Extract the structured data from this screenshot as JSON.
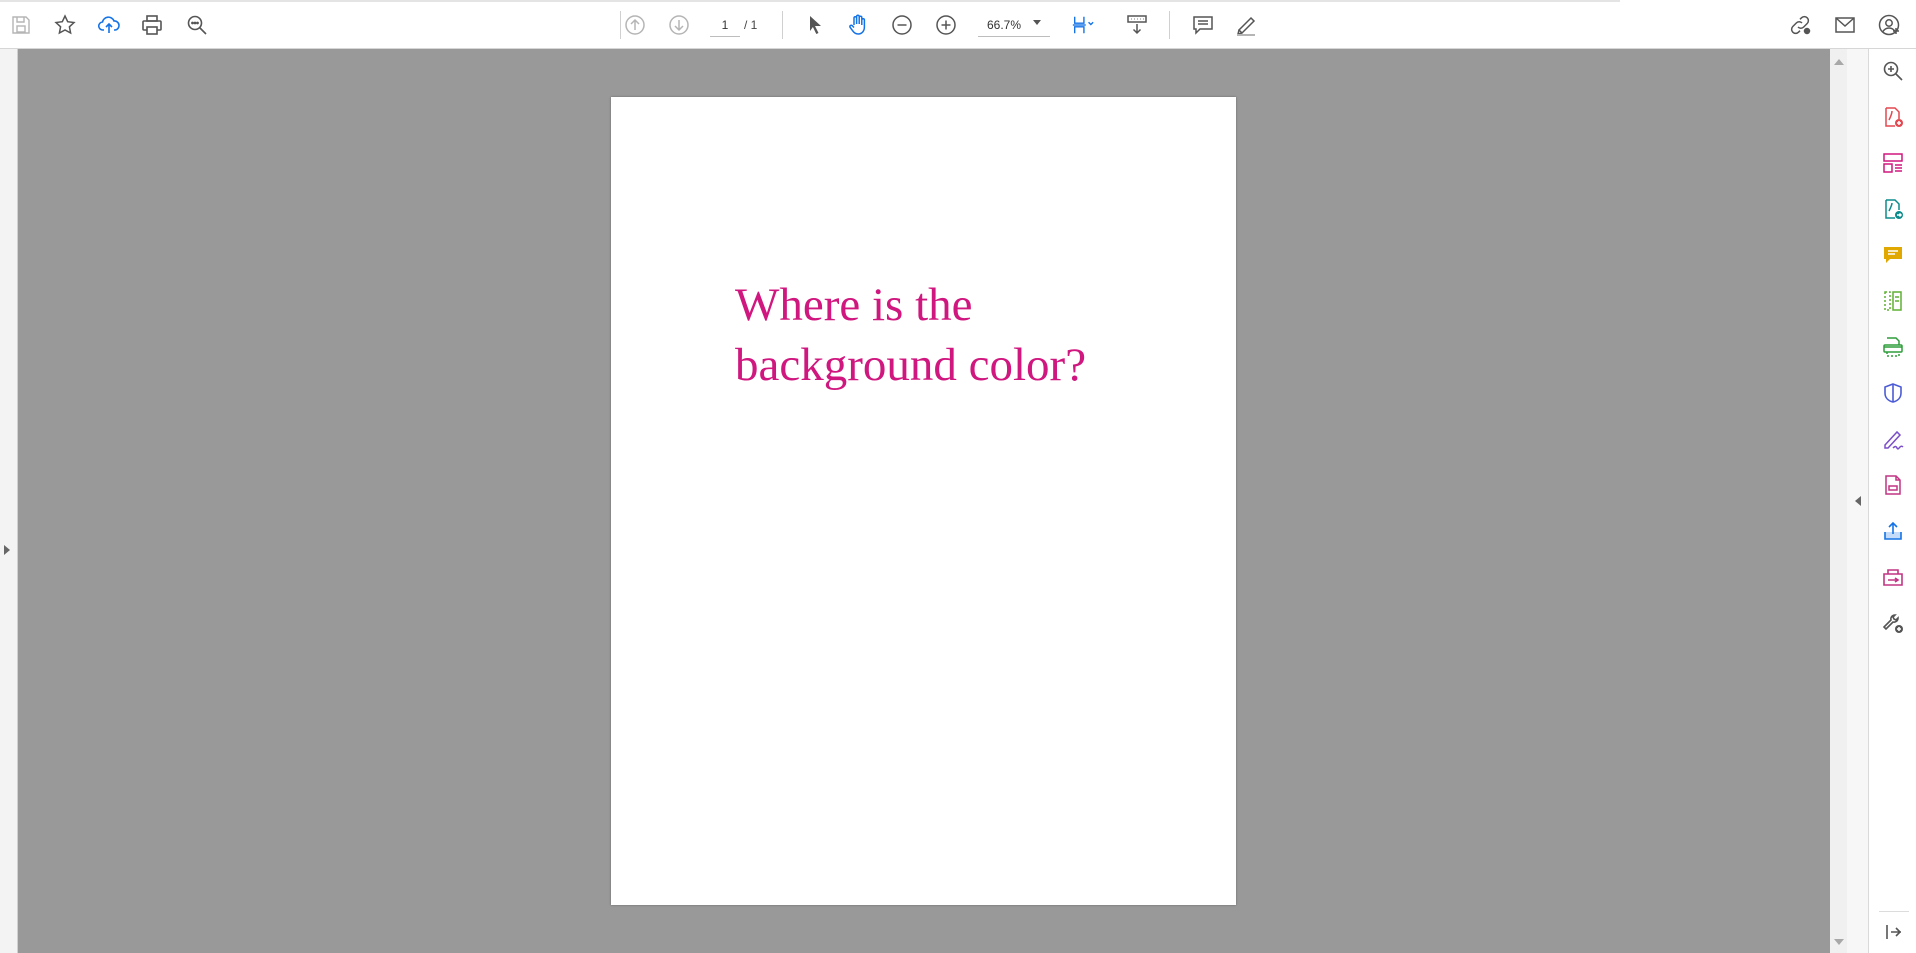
{
  "toolbar": {
    "icons": {
      "save": "save-icon",
      "bookmark": "star-icon",
      "upload": "cloud-upload-icon",
      "print": "print-icon",
      "find": "search-icon",
      "prev_page": "arrow-up-circle-icon",
      "next_page": "arrow-down-circle-icon",
      "select": "pointer-icon",
      "hand": "hand-icon",
      "zoom_out": "zoom-out-icon",
      "zoom_in": "zoom-in-icon",
      "fit": "page-fit-icon",
      "scroll_mode": "scroll-mode-icon",
      "comment": "comment-icon",
      "highlight": "pen-icon",
      "share_link": "link-share-icon",
      "email": "email-icon",
      "account": "account-icon"
    },
    "page_current": "1",
    "page_total": "/ 1",
    "zoom": "66.7%"
  },
  "document": {
    "text": "Where is the background color?",
    "text_color": "#d0177f",
    "background": "#999999"
  },
  "right_panel": {
    "tools": [
      "search-zoom-icon",
      "create-pdf-icon",
      "organize-pages-icon",
      "export-pdf-icon",
      "comment-tool-icon",
      "compare-icon",
      "scan-icon",
      "protect-icon",
      "fill-sign-icon",
      "edit-pdf-icon",
      "share-icon",
      "send-for-review-icon",
      "more-tools-icon",
      "collapse-panel-icon"
    ]
  },
  "colors": {
    "accent_blue": "#1473e6",
    "magenta": "#d0177f",
    "red": "#e34850",
    "teal": "#0d8b8b",
    "yellow": "#e0a800",
    "green": "#2d9d3c",
    "purple": "#7b4fc9"
  }
}
